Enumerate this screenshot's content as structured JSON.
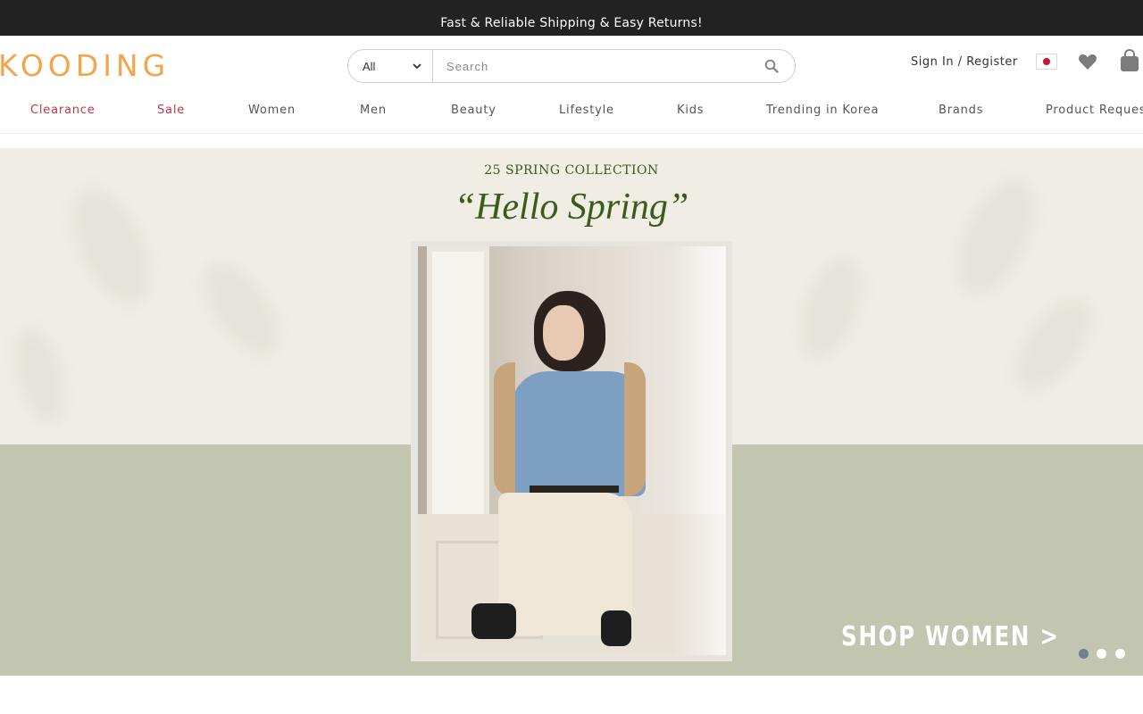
{
  "announcement": "Fast & Reliable Shipping & Easy Returns!",
  "brand": {
    "logo_text": "KOODING",
    "logo_color": "#f4a54a"
  },
  "search": {
    "category": "All",
    "placeholder": "Search"
  },
  "account": {
    "signin_label": "Sign In / Register"
  },
  "icons": {
    "flag": "japan-flag-icon",
    "wishlist": "heart-icon",
    "cart": "shopping-bag-icon",
    "search": "search-icon"
  },
  "nav": [
    {
      "label": "Clearance",
      "highlight": true
    },
    {
      "label": "Sale",
      "highlight": true
    },
    {
      "label": "Women"
    },
    {
      "label": "Men"
    },
    {
      "label": "Beauty"
    },
    {
      "label": "Lifestyle"
    },
    {
      "label": "Kids"
    },
    {
      "label": "Trending in Korea"
    },
    {
      "label": "Brands"
    },
    {
      "label": "Product Reques"
    }
  ],
  "hero": {
    "kicker": "25 SPRING COLLECTION",
    "title": "“Hello Spring”",
    "cta": "SHOP WOMEN >",
    "slides": 3,
    "active_slide": 1,
    "accent": "#3c5a1a"
  }
}
